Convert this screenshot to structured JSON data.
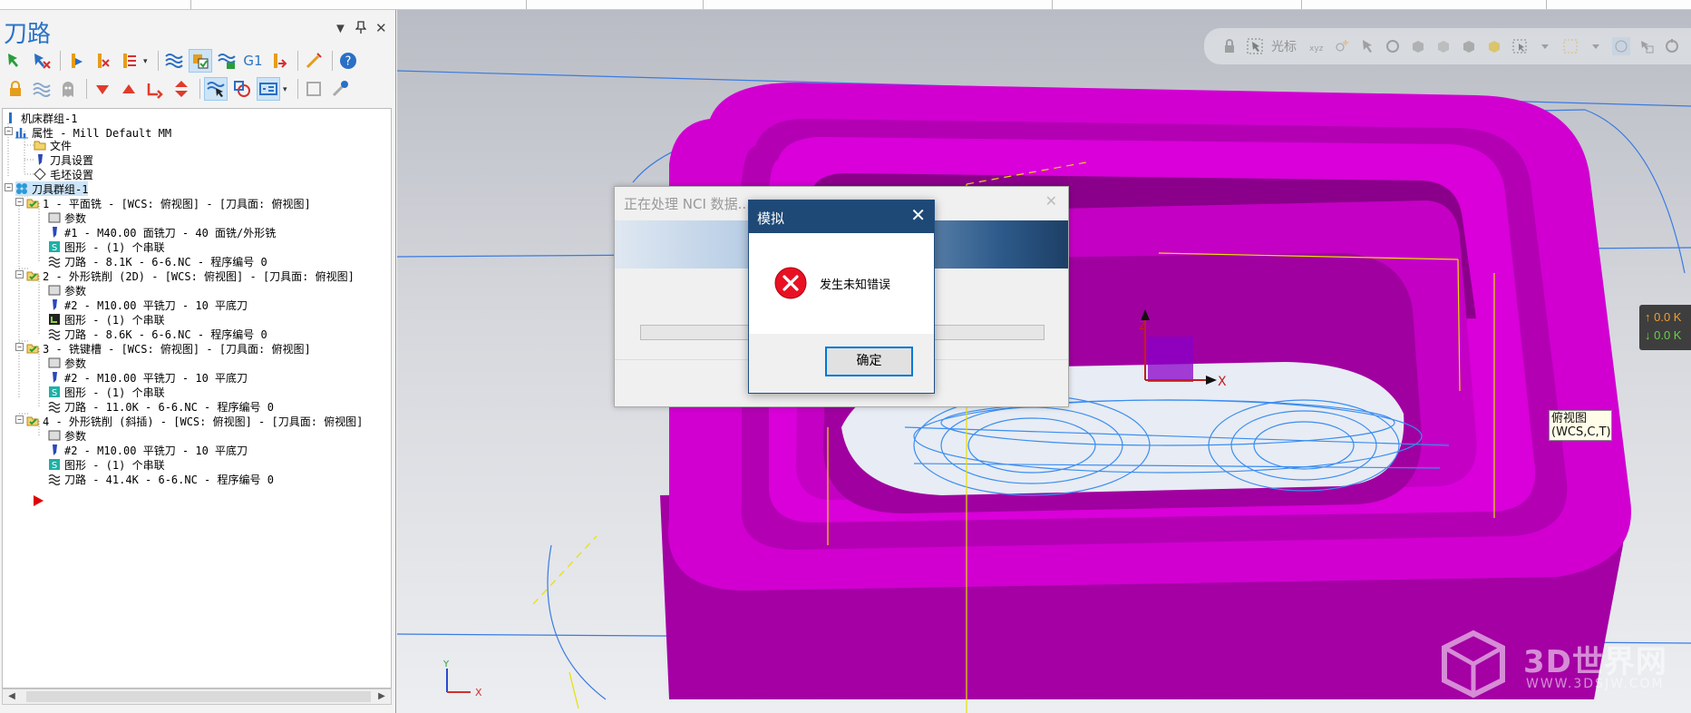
{
  "panel": {
    "title": "刀路",
    "pin_glyph": "▼",
    "dock_glyph": "ᐩ",
    "close_glyph": "✕"
  },
  "toolbar": {
    "g1_label": "G1"
  },
  "tree": {
    "machine_group": "机床群组-1",
    "properties": "属性 - Mill Default MM",
    "files": "文件",
    "tool_settings": "刀具设置",
    "stock_setup": "毛坯设置",
    "toolpath_group": "刀具群组-1",
    "operations": [
      {
        "title": "1 - 平面铣 - [WCS: 俯视图] - [刀具面: 俯视图]",
        "params": "参数",
        "tool": "#1 - M40.00 面铣刀 - 40 面铣/外形铣",
        "geometry": "图形 - (1) 个串联",
        "toolpath": "刀路 - 8.1K - 6-6.NC - 程序编号 0"
      },
      {
        "title": "2 - 外形铣削 (2D) - [WCS: 俯视图] - [刀具面: 俯视图]",
        "params": "参数",
        "tool": "#2 - M10.00 平铣刀 - 10 平底刀",
        "geometry": "图形 - (1) 个串联",
        "toolpath": "刀路 - 8.6K - 6-6.NC - 程序编号 0"
      },
      {
        "title": "3 - 铣键槽 - [WCS: 俯视图] - [刀具面: 俯视图]",
        "params": "参数",
        "tool": "#2 - M10.00 平铣刀 - 10 平底刀",
        "geometry": "图形 - (1) 个串联",
        "toolpath": "刀路 - 11.0K - 6-6.NC - 程序编号 0"
      },
      {
        "title": "4 - 外形铣削 (斜插) - [WCS: 俯视图] - [刀具面: 俯视图]",
        "params": "参数",
        "tool": "#2 - M10.00 平铣刀 - 10 平底刀",
        "geometry": "图形 - (1) 个串联",
        "toolpath": "刀路 - 41.4K - 6-6.NC - 程序编号 0"
      }
    ]
  },
  "viewport": {
    "cursor_label": "光标",
    "view_label_line1": "俯视图",
    "view_label_line2": "(WCS,C,T)",
    "axis_x": "X",
    "axis_z": "Z",
    "axis_y": "Y",
    "right_up": "↑ 0.0 K",
    "right_down": "↓ 0.0 K",
    "watermark_text": "3D世界网",
    "watermark_url": "WWW.3DSJW.COM",
    "part_color": "#d100d1"
  },
  "progress_dialog": {
    "title": "正在处理 NCI 数据...",
    "close_glyph": "✕"
  },
  "error_dialog": {
    "title": "模拟",
    "close_glyph": "✕",
    "message": "发生未知错误",
    "ok_label": "确定"
  }
}
